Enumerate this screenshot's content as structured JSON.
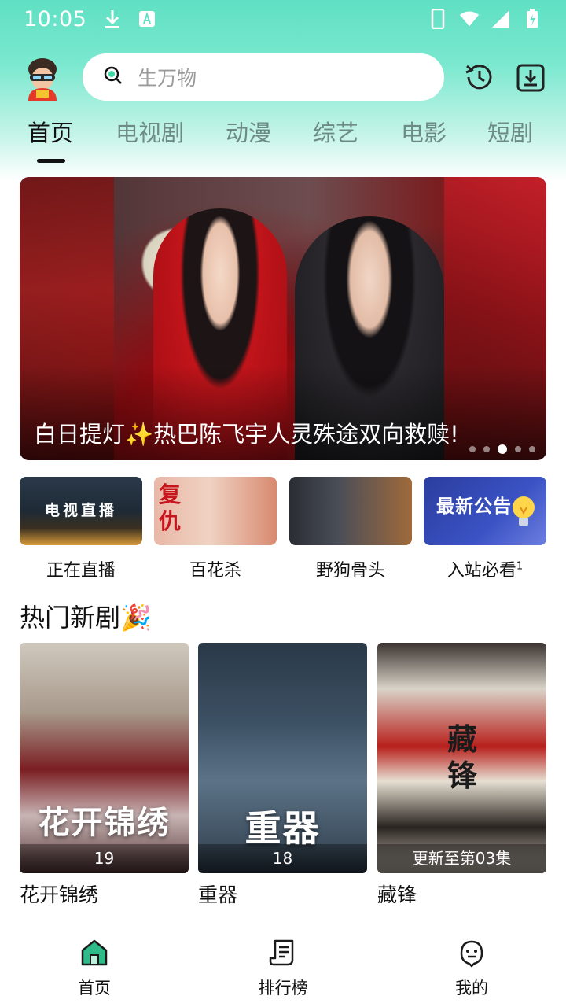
{
  "status_bar": {
    "time": "10:05",
    "left_icons": [
      "download-icon",
      "app-store-icon"
    ],
    "right_icons": [
      "phone-icon",
      "wifi-icon",
      "signal-icon",
      "battery-icon"
    ]
  },
  "header": {
    "avatar": "avatar-icon",
    "search_placeholder": "生万物",
    "history_icon": "history-icon",
    "download_icon": "download-box-icon"
  },
  "tabs": [
    {
      "label": "首页",
      "active": true
    },
    {
      "label": "电视剧",
      "active": false
    },
    {
      "label": "动漫",
      "active": false
    },
    {
      "label": "综艺",
      "active": false
    },
    {
      "label": "电影",
      "active": false
    },
    {
      "label": "短剧",
      "active": false
    }
  ],
  "banner": {
    "caption": "白日提灯✨热巴陈飞宇人灵殊途双向救赎!",
    "dots_total": 5,
    "active_dot": 3
  },
  "quick_entries": [
    {
      "label": "正在直播",
      "thumb_text": "电视直播"
    },
    {
      "label": "百花杀",
      "thumb_text": "复仇"
    },
    {
      "label": "野狗骨头",
      "thumb_text": ""
    },
    {
      "label": "入站必看",
      "superscript": "1",
      "thumb_text": "最新公告"
    }
  ],
  "section": {
    "title": "热门新剧🎉",
    "cards": [
      {
        "title": "花开锦绣",
        "badge": "19",
        "poster_text": "花开锦绣"
      },
      {
        "title": "重器",
        "badge": "18",
        "poster_text": "重器"
      },
      {
        "title": "藏锋",
        "badge": "更新至第03集",
        "poster_text": "藏锋"
      }
    ]
  },
  "bottom_nav": [
    {
      "label": "首页",
      "icon": "home-icon",
      "active": true
    },
    {
      "label": "排行榜",
      "icon": "ranking-icon",
      "active": false
    },
    {
      "label": "我的",
      "icon": "profile-icon",
      "active": false
    }
  ],
  "colors": {
    "accent": "#5fe0c3",
    "tab_inactive": "#6d8a84",
    "home_icon_green": "#2dbb8a"
  }
}
